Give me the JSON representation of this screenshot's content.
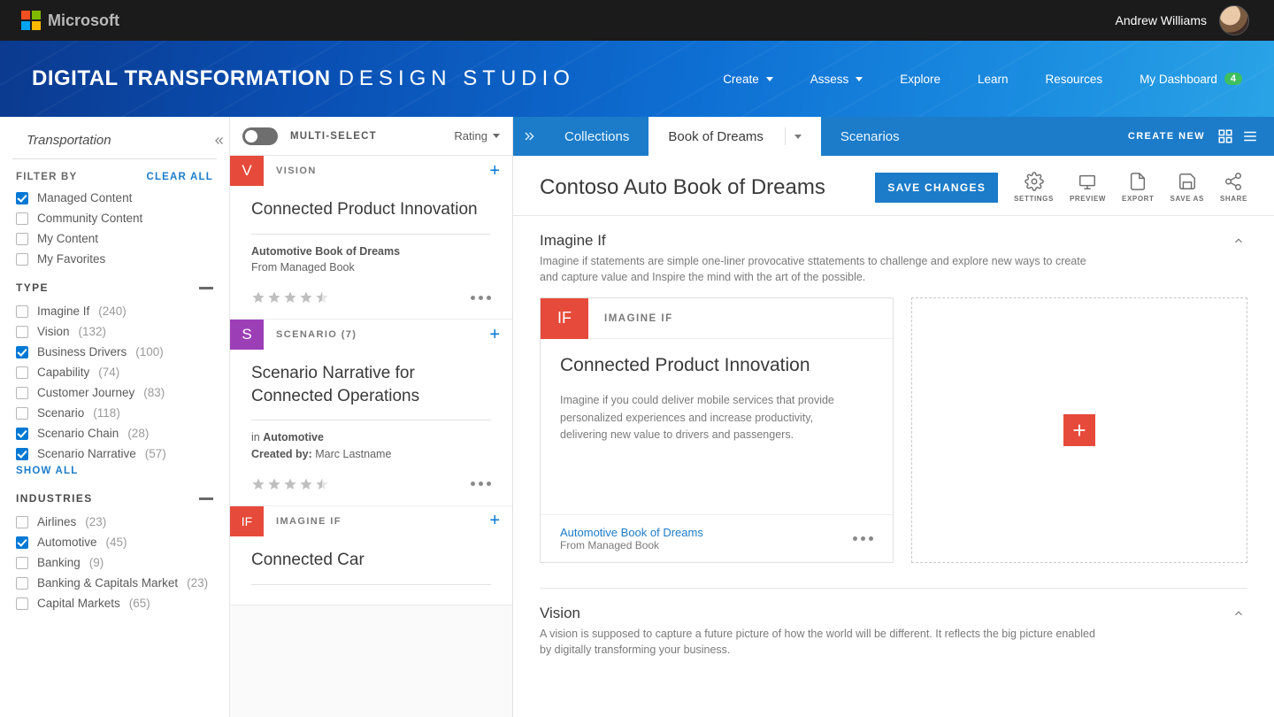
{
  "topbar": {
    "brand": "Microsoft",
    "user_name": "Andrew Williams"
  },
  "hero": {
    "title_bold": "DIGITAL TRANSFORMATION",
    "title_light": "DESIGN STUDIO",
    "nav": {
      "create": "Create",
      "assess": "Assess",
      "explore": "Explore",
      "learn": "Learn",
      "resources": "Resources",
      "dashboard": "My Dashboard",
      "dashboard_badge": "4"
    }
  },
  "search": {
    "value": "Transportation"
  },
  "filters": {
    "header": "FILTER BY",
    "clear": "CLEAR ALL",
    "sources": [
      {
        "label": "Managed Content",
        "checked": true
      },
      {
        "label": "Community Content",
        "checked": false
      },
      {
        "label": "My Content",
        "checked": false
      },
      {
        "label": "My Favorites",
        "checked": false
      }
    ],
    "type_header": "TYPE",
    "types": [
      {
        "label": "Imagine If",
        "count": "(240)",
        "checked": false
      },
      {
        "label": "Vision",
        "count": "(132)",
        "checked": false
      },
      {
        "label": "Business Drivers",
        "count": "(100)",
        "checked": true
      },
      {
        "label": "Capability",
        "count": "(74)",
        "checked": false
      },
      {
        "label": "Customer Journey",
        "count": "(83)",
        "checked": false
      },
      {
        "label": "Scenario",
        "count": "(118)",
        "checked": false
      },
      {
        "label": "Scenario Chain",
        "count": "(28)",
        "checked": true
      },
      {
        "label": "Scenario Narrative",
        "count": "(57)",
        "checked": true
      }
    ],
    "show_all": "SHOW ALL",
    "ind_header": "INDUSTRIES",
    "industries": [
      {
        "label": "Airlines",
        "count": "(23)",
        "checked": false
      },
      {
        "label": "Automotive",
        "count": "(45)",
        "checked": true
      },
      {
        "label": "Banking",
        "count": "(9)",
        "checked": false
      },
      {
        "label": "Banking & Capitals Market",
        "count": "(23)",
        "checked": false
      },
      {
        "label": "Capital Markets",
        "count": "(65)",
        "checked": false
      }
    ]
  },
  "cards_toolbar": {
    "multi": "MULTI-SELECT",
    "sort": "Rating"
  },
  "cards": [
    {
      "tag": "V",
      "tagClass": "v",
      "type": "VISION",
      "count": "",
      "title": "Connected Product Innovation",
      "meta1_strong": "Automotive Book of Dreams",
      "meta2": "From Managed Book"
    },
    {
      "tag": "S",
      "tagClass": "s",
      "type": "SCENARIO",
      "count": "(7)",
      "title": "Scenario Narrative for Connected Operations",
      "meta1_pre": "in ",
      "meta1_strong": "Automotive",
      "meta2_pre": "Created by: ",
      "meta2": "Marc Lastname"
    },
    {
      "tag": "IF",
      "tagClass": "if",
      "type": "IMAGINE IF",
      "count": "",
      "title": "Connected Car"
    }
  ],
  "tabs": {
    "collections": "Collections",
    "book": "Book of Dreams",
    "scenarios": "Scenarios",
    "create_new": "CREATE NEW"
  },
  "doc": {
    "title": "Contoso Auto Book of Dreams",
    "save": "SAVE CHANGES",
    "actions": {
      "settings": "SETTINGS",
      "preview": "PREVIEW",
      "export": "EXPORT",
      "saveas": "SAVE AS",
      "share": "SHARE"
    }
  },
  "sections": {
    "imagine": {
      "title": "Imagine If",
      "desc": "Imagine if statements are simple one-liner provocative sttatements to challenge and explore new ways to create and capture value and Inspire the mind with the art of the possible."
    },
    "vision": {
      "title": "Vision",
      "desc": "A vision is supposed to capture a future picture of how the world will be different. It reflects the big picture enabled by digitally transforming your business."
    }
  },
  "big_card": {
    "tag": "IF",
    "type": "IMAGINE IF",
    "title": "Connected Product Innovation",
    "desc": "Imagine if you could deliver mobile services that provide personalized experiences and increase productivity, delivering new value to drivers and passengers.",
    "link": "Automotive Book of Dreams",
    "src": "From Managed Book"
  }
}
